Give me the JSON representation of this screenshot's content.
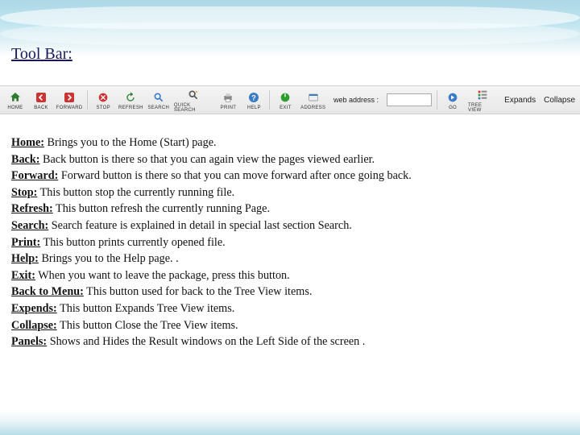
{
  "title": "Tool Bar:",
  "toolbar": {
    "items": [
      {
        "label": "HOME"
      },
      {
        "label": "BACK"
      },
      {
        "label": "FORWARD"
      },
      {
        "label": "STOP"
      },
      {
        "label": "REFRESH"
      },
      {
        "label": "SEARCH"
      },
      {
        "label": "QUICK SEARCH"
      },
      {
        "label": "PRINT"
      },
      {
        "label": "HELP"
      },
      {
        "label": "EXIT"
      },
      {
        "label": "ADDRESS"
      }
    ],
    "address_label": "web address :",
    "address_value": "",
    "go_label": "GO",
    "treeview_label": "TREE VIEW",
    "expand_label": "Expands",
    "collapse_label": "Collapse"
  },
  "descriptions": [
    {
      "term": "Home:",
      "text": " Brings you to the Home (Start) page."
    },
    {
      "term": "Back:",
      "text": " Back button is there so that you can again view the pages viewed earlier."
    },
    {
      "term": "Forward:",
      "text": " Forward button is there so that you can move forward after once going back."
    },
    {
      "term": "Stop:",
      "text": " This button  stop the currently running file."
    },
    {
      "term": "Refresh:",
      "text": " This button  refresh the currently running Page."
    },
    {
      "term": "Search:",
      "text": " Search feature is explained in detail in special last section Search."
    },
    {
      "term": "Print:",
      "text": " This button prints currently opened file."
    },
    {
      "term": "Help:",
      "text": "  Brings you to the Help page. ."
    },
    {
      "term": "Exit:",
      "text": " When you want to leave the package, press this button."
    },
    {
      "term": "Back to Menu:",
      "text": " This button  used for back to the Tree View items."
    },
    {
      "term": "Expends:",
      "text": " This button  Expands Tree View items."
    },
    {
      "term": "Collapse:",
      "text": " This button  Close the Tree View items."
    },
    {
      "term": "Panels:",
      "text": " Shows and Hides the Result windows on the Left Side of the screen ."
    }
  ]
}
